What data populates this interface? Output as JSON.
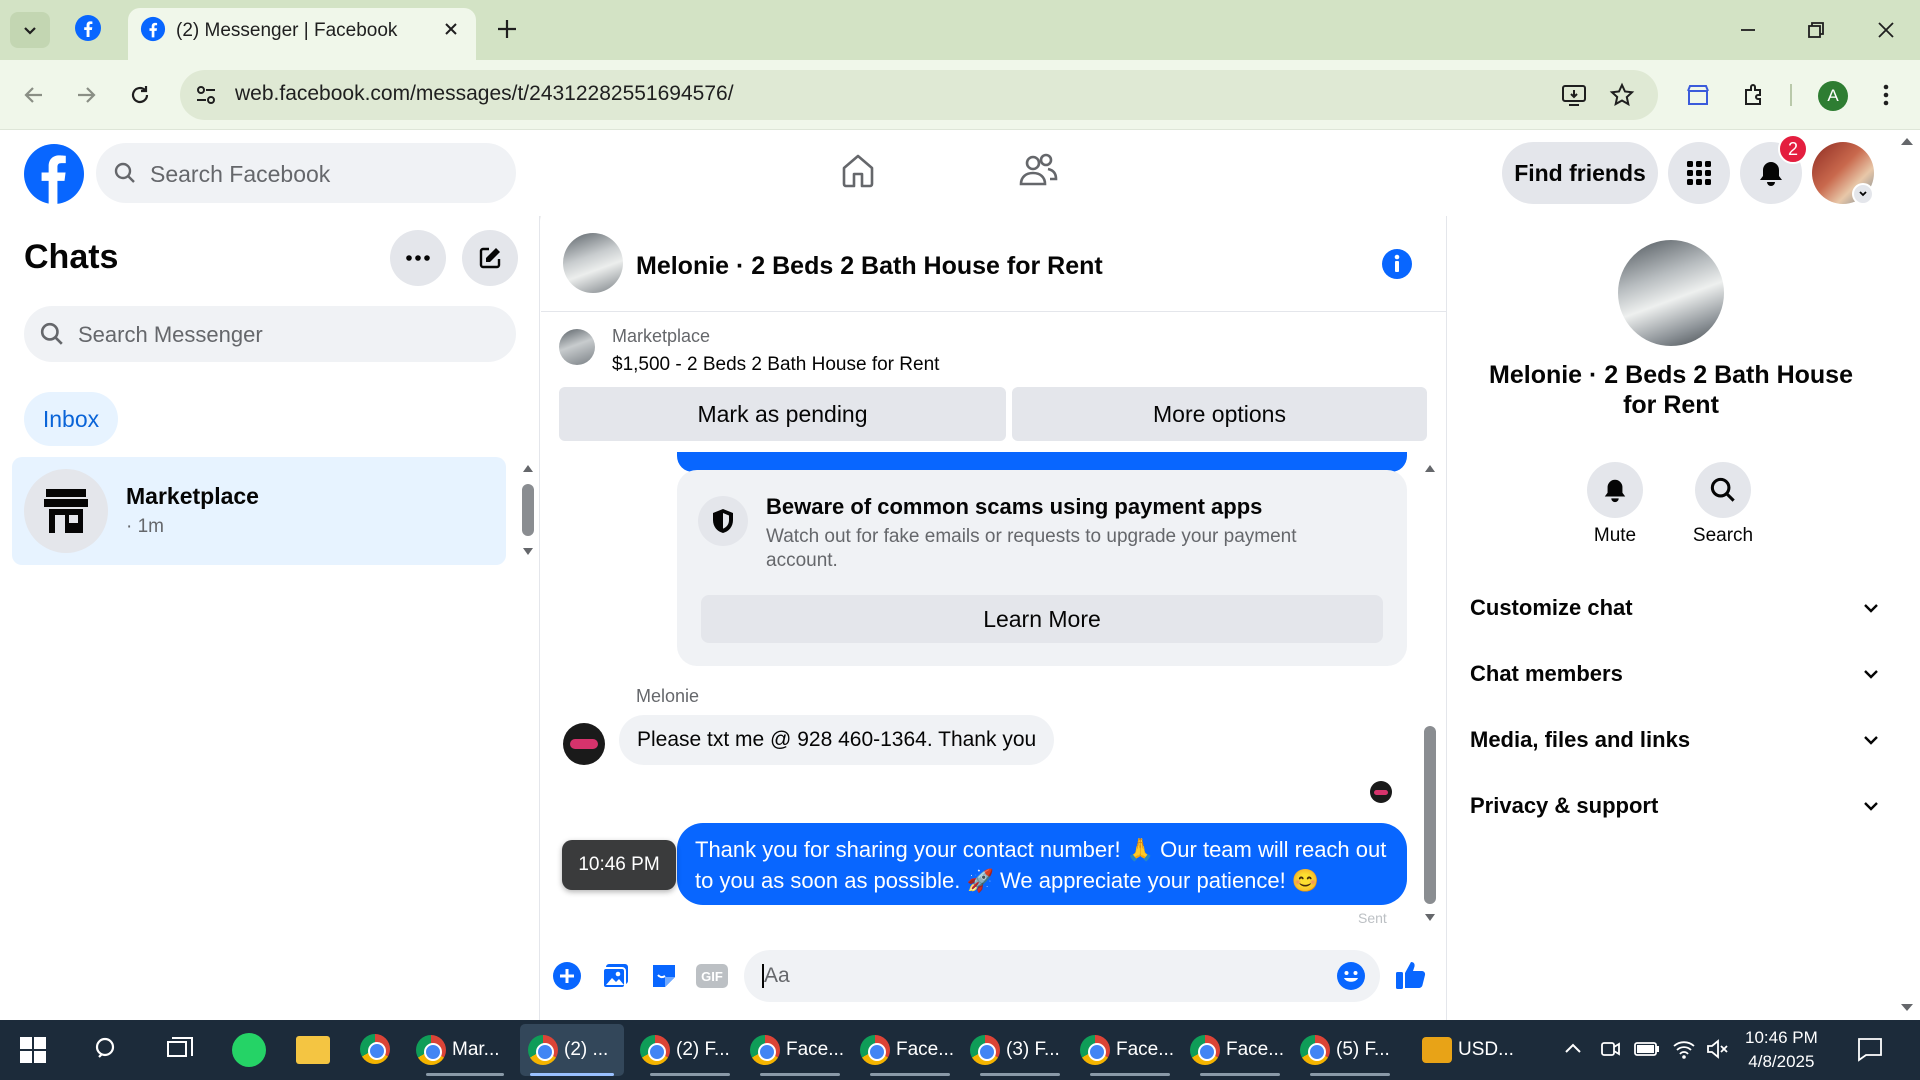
{
  "browser": {
    "tab_title": "(2) Messenger | Facebook",
    "url": "web.facebook.com/messages/t/24312282551694576/",
    "profile_initial": "A"
  },
  "fb_header": {
    "search_placeholder": "Search Facebook",
    "find_friends": "Find friends",
    "notification_count": "2"
  },
  "left": {
    "title": "Chats",
    "search_placeholder": "Search Messenger",
    "inbox": "Inbox",
    "conversations": [
      {
        "name": "Marketplace",
        "time": "· 1m"
      }
    ]
  },
  "chat": {
    "title": "Melonie · 2 Beds 2 Bath House for Rent",
    "listing_label": "Marketplace",
    "listing_text": "$1,500 - 2 Beds 2 Bath House for Rent",
    "mark_pending": "Mark as pending",
    "more_options": "More options",
    "scam_title": "Beware of common scams using payment apps",
    "scam_body": "Watch out for fake emails or requests to upgrade your payment account.",
    "learn_more": "Learn More",
    "sender": "Melonie",
    "incoming_message": "Please txt me @ 928 460-1364.  Thank you",
    "outgoing_message": "Thank you for sharing your contact number! 🙏 Our team will reach out to you as soon as possible. 🚀 We appreciate your patience! 😊",
    "time_tooltip": "10:46 PM",
    "sent_label": "Sent",
    "composer_placeholder": "Aa"
  },
  "right": {
    "title": "Melonie · 2 Beds 2 Bath House for Rent",
    "mute": "Mute",
    "search": "Search",
    "sections": [
      "Customize chat",
      "Chat members",
      "Media, files and links",
      "Privacy & support"
    ]
  },
  "taskbar": {
    "apps": [
      "Mar...",
      "(2) ...",
      "(2) F...",
      "Face...",
      "Face...",
      "(3) F...",
      "Face...",
      "Face...",
      "(5) F..."
    ],
    "currency": "USD...",
    "time": "10:46 PM",
    "date": "4/8/2025"
  },
  "colors": {
    "fb_blue": "#0866ff",
    "chrome_frame": "#d3e3c5",
    "taskbar": "#1c2b3a"
  }
}
